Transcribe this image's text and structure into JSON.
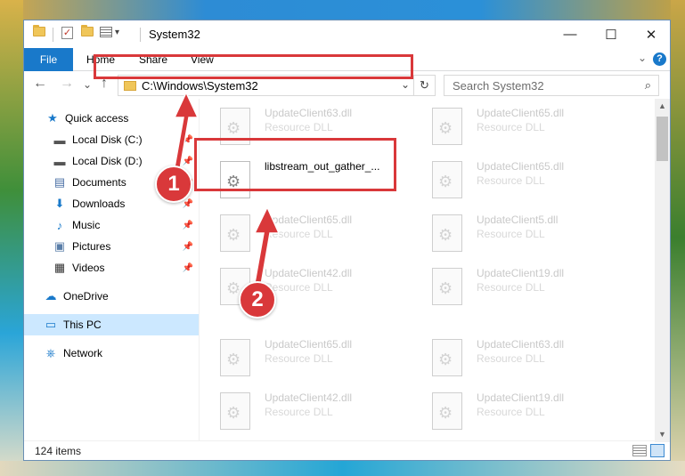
{
  "window": {
    "title": "System32",
    "controls": {
      "minimize": "—",
      "maximize": "☐",
      "close": "✕"
    }
  },
  "ribbon": {
    "file": "File",
    "tabs": [
      "Home",
      "Share",
      "View"
    ],
    "help": "?"
  },
  "nav": {
    "back": "←",
    "forward": "→",
    "recent": "⌄",
    "up": "↑",
    "address": "C:\\Windows\\System32",
    "address_dropdown": "⌄",
    "refresh": "↻",
    "search_placeholder": "Search System32",
    "search_icon": "⌕"
  },
  "sidebar": {
    "items": [
      {
        "label": "Quick access",
        "icon": "★",
        "icon_name": "star-icon"
      },
      {
        "label": "Local Disk (C:)",
        "icon": "▬",
        "icon_name": "drive-icon",
        "pinned": true
      },
      {
        "label": "Local Disk (D:)",
        "icon": "▬",
        "icon_name": "drive-icon",
        "pinned": true
      },
      {
        "label": "Documents",
        "icon": "▤",
        "icon_name": "documents-icon",
        "pinned": true
      },
      {
        "label": "Downloads",
        "icon": "⬇",
        "icon_name": "downloads-icon",
        "pinned": true
      },
      {
        "label": "Music",
        "icon": "♪",
        "icon_name": "music-icon",
        "pinned": true
      },
      {
        "label": "Pictures",
        "icon": "▣",
        "icon_name": "pictures-icon",
        "pinned": true
      },
      {
        "label": "Videos",
        "icon": "▦",
        "icon_name": "videos-icon",
        "pinned": true
      },
      {
        "label": "OneDrive",
        "icon": "☁",
        "icon_name": "onedrive-icon"
      },
      {
        "label": "This PC",
        "icon": "▭",
        "icon_name": "this-pc-icon",
        "selected": true
      },
      {
        "label": "Network",
        "icon": "⎈",
        "icon_name": "network-icon"
      }
    ],
    "pin_glyph": "📌"
  },
  "files": [
    {
      "name": "UpdateClient63.dll",
      "type": "Resource DLL"
    },
    {
      "name": "UpdateClient65.dll",
      "type": "Resource DLL"
    },
    {
      "name": "libstream_out_gather_...",
      "type": "",
      "active": true
    },
    {
      "name": "UpdateClient65.dll",
      "type": "Resource DLL"
    },
    {
      "name": "UpdateClient65.dll",
      "type": "Resource DLL"
    },
    {
      "name": "UpdateClient5.dll",
      "type": "Resource DLL"
    },
    {
      "name": "UpdateClient42.dll",
      "type": "Resource DLL"
    },
    {
      "name": "UpdateClient19.dll",
      "type": "Resource DLL"
    },
    {
      "name": "UpdateClient65.dll",
      "type": "Resource DLL"
    },
    {
      "name": "UpdateClient63.dll",
      "type": "Resource DLL"
    },
    {
      "name": "UpdateClient42.dll",
      "type": "Resource DLL"
    },
    {
      "name": "UpdateClient19.dll",
      "type": "Resource DLL"
    }
  ],
  "status": {
    "count": "124 items"
  },
  "annotations": {
    "step1": "1",
    "step2": "2"
  },
  "colors": {
    "accent": "#1979ca",
    "highlight": "#d9383a",
    "selected": "#cce8ff"
  }
}
